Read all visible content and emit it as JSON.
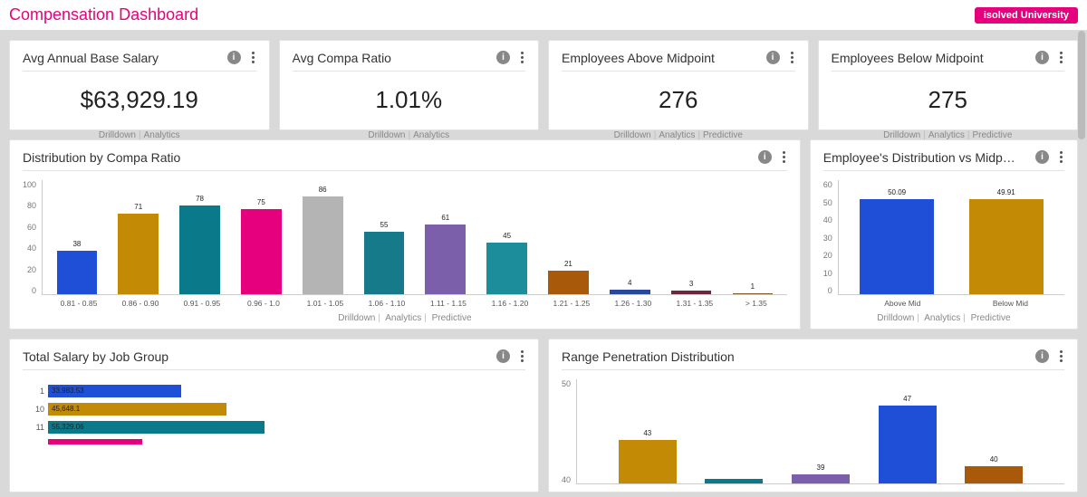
{
  "header": {
    "title": "Compensation Dashboard",
    "university_btn": "isolved University"
  },
  "footer_links": {
    "drilldown": "Drilldown",
    "analytics": "Analytics",
    "predictive": "Predictive"
  },
  "kpis": [
    {
      "title": "Avg Annual Base Salary",
      "value": "$63,929.19",
      "predictive": false
    },
    {
      "title": "Avg Compa Ratio",
      "value": "1.01%",
      "predictive": false
    },
    {
      "title": "Employees Above Midpoint",
      "value": "276",
      "predictive": true
    },
    {
      "title": "Employees Below Midpoint",
      "value": "275",
      "predictive": true
    }
  ],
  "chart_data": [
    {
      "id": "compa_ratio",
      "type": "bar",
      "title": "Distribution by Compa Ratio",
      "ylim": [
        0,
        100
      ],
      "yticks": [
        0,
        20,
        40,
        60,
        80,
        100
      ],
      "categories": [
        "0.81 - 0.85",
        "0.86 - 0.90",
        "0.91 - 0.95",
        "0.96 - 1.0",
        "1.01 - 1.05",
        "1.06 - 1.10",
        "1.11 - 1.15",
        "1.16 - 1.20",
        "1.21 - 1.25",
        "1.26 - 1.30",
        "1.31 - 1.35",
        "> 1.35"
      ],
      "values": [
        38,
        71,
        78,
        75,
        86,
        55,
        61,
        45,
        21,
        4,
        3,
        1
      ],
      "colors": [
        "c-blue",
        "c-gold",
        "c-teal",
        "c-pink",
        "c-grey",
        "c-teal2",
        "c-purple",
        "c-teal3",
        "c-brown",
        "c-dblue",
        "c-maroon",
        "c-brown2"
      ],
      "footer_predictive": true
    },
    {
      "id": "emp_vs_mid",
      "type": "bar",
      "title": "Employee's Distribution vs Midp…",
      "ylim": [
        0,
        60
      ],
      "yticks": [
        0,
        10,
        20,
        30,
        40,
        50,
        60
      ],
      "categories": [
        "Above Mid",
        "Below Mid"
      ],
      "values": [
        50.09,
        49.91
      ],
      "colors": [
        "c-blue",
        "c-gold"
      ],
      "footer_predictive": true
    },
    {
      "id": "salary_jobgroup",
      "type": "bar_h",
      "title": "Total Salary by Job Group",
      "categories": [
        "1",
        "10",
        "11"
      ],
      "values": [
        33983.53,
        45648.1,
        55329.06
      ],
      "xmax": 120000,
      "colors": [
        "c-blue",
        "c-gold",
        "c-teal"
      ]
    },
    {
      "id": "range_pen",
      "type": "bar",
      "title": "Range Penetration Distribution",
      "ylim": [
        38,
        50
      ],
      "yticks": [
        40,
        50
      ],
      "values": [
        43,
        38.5,
        39,
        47,
        40
      ],
      "colors": [
        "c-gold",
        "c-teal",
        "c-purple",
        "c-blue",
        "c-brown"
      ],
      "value_labels": [
        "43",
        "",
        "39",
        "47",
        "40"
      ]
    }
  ]
}
